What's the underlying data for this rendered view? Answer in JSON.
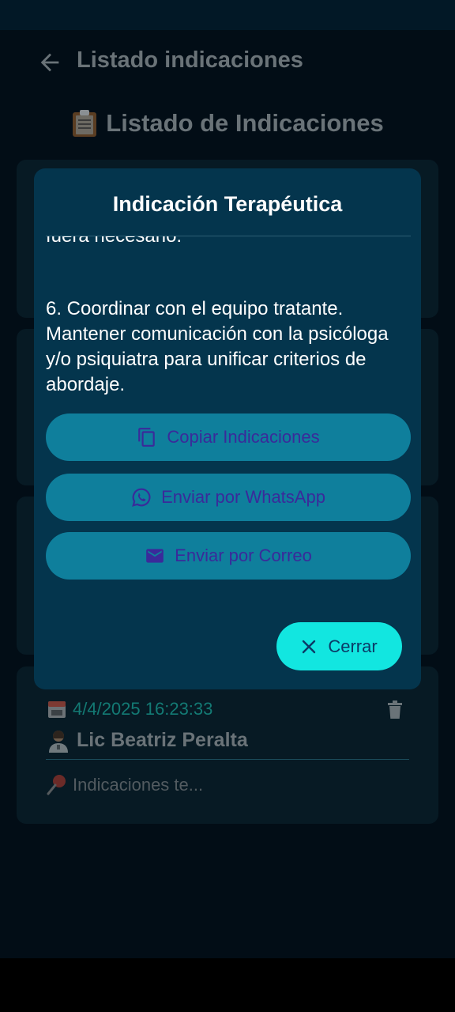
{
  "appbar": {
    "title": "Listado indicaciones",
    "back_icon": "arrow-left-icon"
  },
  "page": {
    "heading": "Listado de Indicaciones",
    "heading_icon": "clipboard-icon"
  },
  "cards": [
    {
      "date": "4/4/2025 16:23:33",
      "author": "Lic Beatriz Peralta",
      "preview": "Indicaciones te...",
      "date_icon": "calendar-icon",
      "author_icon": "health-worker-icon",
      "pin_icon": "pushpin-icon",
      "delete_icon": "trash-icon"
    }
  ],
  "dialog": {
    "title": "Indicación Terapéutica",
    "partial_line": "fuera necesario.",
    "paragraph": "6. Coordinar con el equipo tratante. Mantener comunicación con la psicóloga y/o psiquiatra para unificar criterios de abordaje.",
    "buttons": {
      "copy": {
        "label": "Copiar Indicaciones",
        "icon": "copy-icon"
      },
      "whatsapp": {
        "label": "Enviar por WhatsApp",
        "icon": "whatsapp-icon"
      },
      "email": {
        "label": "Enviar por Correo",
        "icon": "mail-icon"
      }
    },
    "close": {
      "label": "Cerrar",
      "icon": "close-icon"
    }
  },
  "colors": {
    "dialog_bg": "#04354d",
    "action_button": "#0f7f9c",
    "action_label": "#3a2a9a",
    "close_button": "#12e6e0",
    "date_text": "#137a74"
  }
}
